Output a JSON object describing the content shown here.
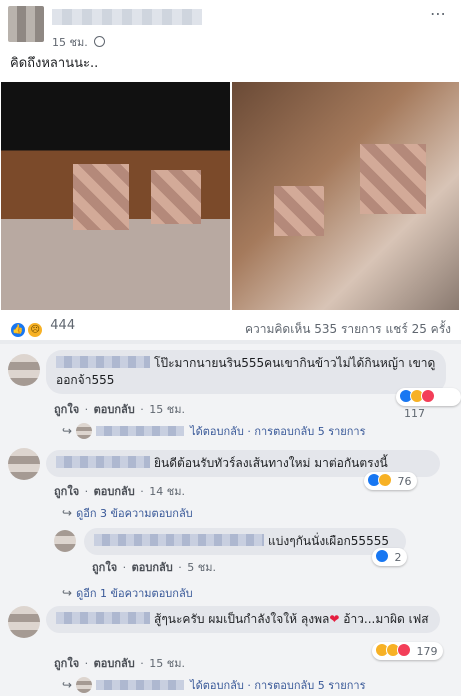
{
  "post": {
    "time": "15 ชม.",
    "text": "คิดถึงหลานนะ..",
    "reaction_count": "444",
    "stats": "ความคิดเห็น 535 รายการ  แชร์ 25 ครั้ง",
    "more_icon": "⋯"
  },
  "comments": [
    {
      "text": "โป๊ะมากนายนริน555คนเขากินข้าวไม่ได้กินหญ้า เขาดูออกจ้า555",
      "like": "ถูกใจ",
      "reply": "ตอบกลับ",
      "time": "15 ชม.",
      "reaction_count": "117",
      "replied_text": "ได้ตอบกลับ · การตอบกลับ 5 รายการ"
    },
    {
      "text": "ยินดีต้อนรับทัวร์ลงเส้นทางใหม่ มาต่อกันตรงนี้",
      "like": "ถูกใจ",
      "reply": "ตอบกลับ",
      "time": "14 ชม.",
      "reaction_count": "76",
      "more_replies": "ดูอีก 3 ข้อความตอบกลับ",
      "sub_reply": {
        "text": "แบ่งๆกันนั่งเผือก55555",
        "like": "ถูกใจ",
        "reply": "ตอบกลับ",
        "time": "5 ชม.",
        "reaction_count": "2"
      },
      "more_replies_2": "ดูอีก 1 ข้อความตอบกลับ"
    },
    {
      "text_a": "สู้ๆนะครับ ผมเป็นกำลังใจให้ ลุงพล",
      "heart": "❤",
      "text_b": " อ้าว...มาผิด เฟส",
      "like": "ถูกใจ",
      "reply": "ตอบกลับ",
      "time": "15 ชม.",
      "reaction_count": "179",
      "replied_text": "ได้ตอบกลับ · การตอบกลับ 5 รายการ"
    }
  ],
  "separator": " · ",
  "colors": {
    "like": "#1877f2",
    "love": "#f33e58",
    "haha": "#f7b125",
    "bubble": "#e4e6eb"
  }
}
